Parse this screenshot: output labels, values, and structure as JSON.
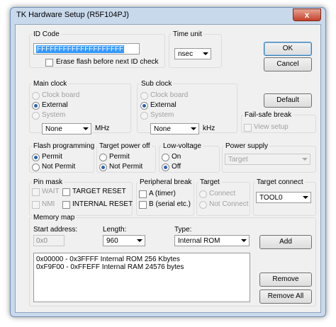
{
  "window": {
    "title": "TK Hardware Setup (R5F104PJ)",
    "close_glyph": "x"
  },
  "id_code": {
    "label": "ID Code",
    "value": "FFFFFFFFFFFFFFFFFFFF",
    "erase_label": "Erase flash before next ID check"
  },
  "time_unit": {
    "label": "Time unit",
    "value": "nsec"
  },
  "buttons": {
    "ok": "OK",
    "cancel": "Cancel",
    "default": "Default",
    "add": "Add",
    "remove": "Remove",
    "remove_all": "Remove All"
  },
  "main_clock": {
    "label": "Main clock",
    "options": [
      "Clock board",
      "External",
      "System"
    ],
    "selected": "External",
    "freq": "None",
    "unit": "MHz"
  },
  "sub_clock": {
    "label": "Sub clock",
    "options": [
      "Clock board",
      "External",
      "System"
    ],
    "selected": "External",
    "freq": "None",
    "unit": "kHz"
  },
  "failsafe": {
    "label": "Fail-safe break",
    "view_setup": "View setup"
  },
  "flash_programming": {
    "label": "Flash programming",
    "options": [
      "Permit",
      "Not Permit"
    ],
    "selected": "Permit"
  },
  "target_power_off": {
    "label": "Target power off",
    "options": [
      "Permit",
      "Not Permit"
    ],
    "selected": "Not Permit"
  },
  "low_voltage": {
    "label": "Low-voltage",
    "options": [
      "On",
      "Off"
    ],
    "selected": "Off"
  },
  "power_supply": {
    "label": "Power supply",
    "value": "Target"
  },
  "pin_mask": {
    "label": "Pin mask",
    "items": [
      "WAIT",
      "TARGET RESET",
      "NMI",
      "INTERNAL RESET"
    ]
  },
  "peripheral_break": {
    "label": "Peripheral break",
    "items": [
      "A (timer)",
      "B (serial etc.)"
    ]
  },
  "target": {
    "label": "Target",
    "options": [
      "Connect",
      "Not Connect"
    ]
  },
  "target_connect": {
    "label": "Target connect",
    "value": "TOOL0"
  },
  "memory_map": {
    "label": "Memory map",
    "start_label": "Start address:",
    "start_value": "0x0",
    "length_label": "Length:",
    "length_value": "960",
    "type_label": "Type:",
    "type_value": "Internal ROM",
    "entries": [
      "0x00000 - 0x3FFFF Internal ROM  256  Kbytes",
      "0xF9F00 - 0xFFEFF Internal RAM  24576  bytes"
    ]
  }
}
